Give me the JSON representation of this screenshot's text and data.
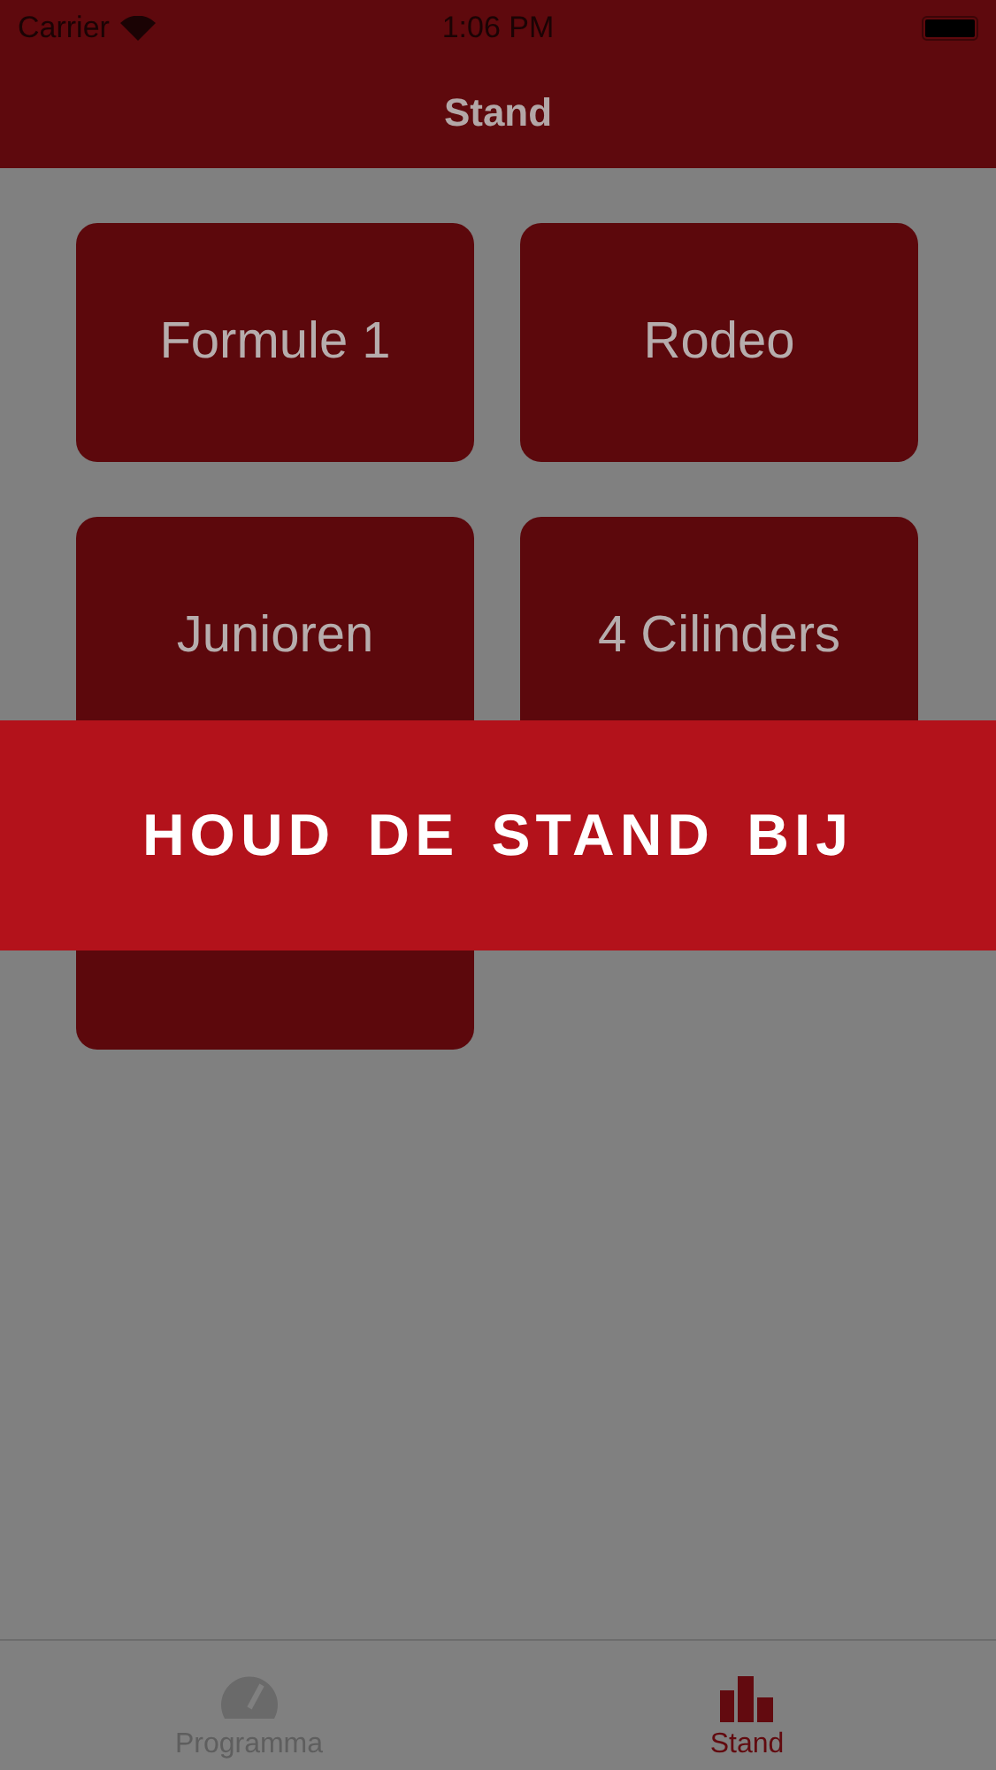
{
  "status_bar": {
    "carrier": "Carrier",
    "time": "1:06 PM"
  },
  "nav_bar": {
    "title": "Stand"
  },
  "tiles": [
    {
      "kind": "labeled",
      "label": "Formule 1"
    },
    {
      "kind": "labeled",
      "label": "Rodeo"
    },
    {
      "kind": "labeled",
      "label": "Junioren"
    },
    {
      "kind": "labeled",
      "label": "4 Cilinders"
    },
    {
      "kind": "covered"
    }
  ],
  "banner": {
    "text": "HOUD DE STAND BIJ"
  },
  "tab_bar": [
    {
      "label": "Programma",
      "selected": false
    },
    {
      "label": "Stand",
      "selected": true
    }
  ]
}
